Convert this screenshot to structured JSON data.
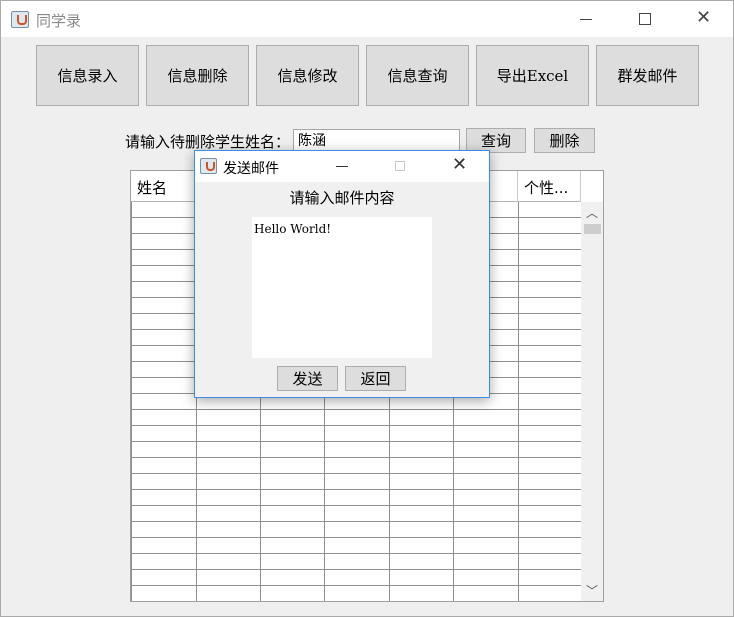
{
  "window": {
    "title": "同学录"
  },
  "toolbar": {
    "buttons": [
      "信息录入",
      "信息删除",
      "信息修改",
      "信息查询",
      "导出Excel",
      "群发邮件"
    ]
  },
  "delete_form": {
    "label": "请输入待删除学生姓名：",
    "name_value": "陈涵",
    "query_label": "查询",
    "delete_label": "删除"
  },
  "table": {
    "headers": [
      "姓名",
      "",
      "",
      "",
      "",
      "",
      "个性..."
    ]
  },
  "dialog": {
    "title": "发送邮件",
    "prompt": "请输入邮件内容",
    "content": "Hello World!",
    "send_label": "发送",
    "back_label": "返回"
  }
}
